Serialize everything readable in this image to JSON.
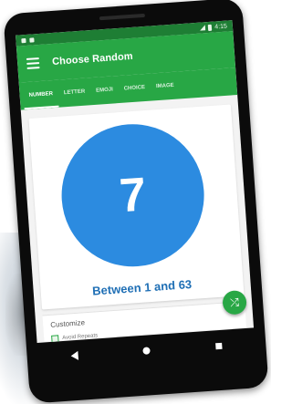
{
  "status_bar": {
    "time": "4:15"
  },
  "app_bar": {
    "title": "Choose Random",
    "menu_icon": "hamburger-menu-icon"
  },
  "tabs": [
    {
      "label": "NUMBER",
      "active": true
    },
    {
      "label": "LETTER",
      "active": false
    },
    {
      "label": "EMOJI",
      "active": false
    },
    {
      "label": "CHOICE",
      "active": false
    },
    {
      "label": "IMAGE",
      "active": false
    }
  ],
  "result": {
    "value": "7",
    "range_text": "Between 1 and 63"
  },
  "customize": {
    "label": "Customize",
    "avoid_label": "Avoid Repeats"
  },
  "fab": {
    "icon": "shuffle-icon"
  },
  "colors": {
    "accent_green": "#28a745",
    "status_green": "#1e7e34",
    "circle_blue": "#2c8be0",
    "range_text_blue": "#1f6fb5"
  }
}
